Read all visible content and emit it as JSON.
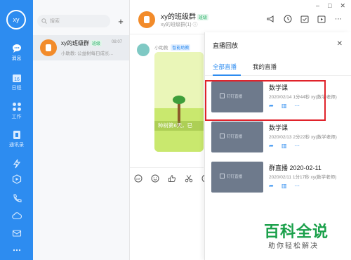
{
  "user": {
    "avatar_text": "xy"
  },
  "nav": {
    "items": [
      {
        "label": "消息",
        "icon": "chat-bubble-icon",
        "active": true
      },
      {
        "label": "日程",
        "icon": "calendar-icon",
        "active": false
      },
      {
        "label": "工作",
        "icon": "apps-grid-icon",
        "active": false
      },
      {
        "label": "通讯录",
        "icon": "contacts-icon",
        "active": false
      },
      {
        "label": "",
        "icon": "lightning-icon",
        "active": false
      },
      {
        "label": "",
        "icon": "play-hexagon-icon",
        "active": false
      },
      {
        "label": "",
        "icon": "phone-icon",
        "active": false
      },
      {
        "label": "",
        "icon": "cloud-icon",
        "active": false
      },
      {
        "label": "",
        "icon": "mail-icon",
        "active": false
      },
      {
        "label": "",
        "icon": "more-dots-icon",
        "active": false
      }
    ]
  },
  "convlist": {
    "search_placeholder": "搜索",
    "items": [
      {
        "name": "xy的班级群",
        "tag": "班级",
        "time": "08:07",
        "preview": "小助教: 公益树每日成长..."
      }
    ]
  },
  "chat": {
    "title": "xy的班级群",
    "tag": "班级",
    "subtitle": "xy的班级群(1) ⓘ",
    "window_controls": [
      "–",
      "□",
      "✕"
    ],
    "message": {
      "sender": "小助教",
      "sender_badge": "智能助教",
      "caption": "种树第6天，已"
    }
  },
  "panel": {
    "title": "直播回放",
    "close": "✕",
    "tabs": [
      "全部直播",
      "我的直播"
    ],
    "thumb_text": "钉钉直播",
    "records": [
      {
        "title": "数学课",
        "meta": "2020/02/14  1分44秒  xy(数学老师)"
      },
      {
        "title": "数学课",
        "meta": "2020/02/13  2分22秒  xy(数学老师)"
      },
      {
        "title": "群直播 2020-02-11",
        "meta": "2020/02/11  1分17秒  xy(数学老师)"
      }
    ]
  },
  "watermark": {
    "big": "百科全说",
    "small": "助你轻松解决"
  },
  "colors": {
    "accent": "#2d8cf0",
    "highlight": "#e0232b",
    "brand_green": "#1aa04a"
  }
}
